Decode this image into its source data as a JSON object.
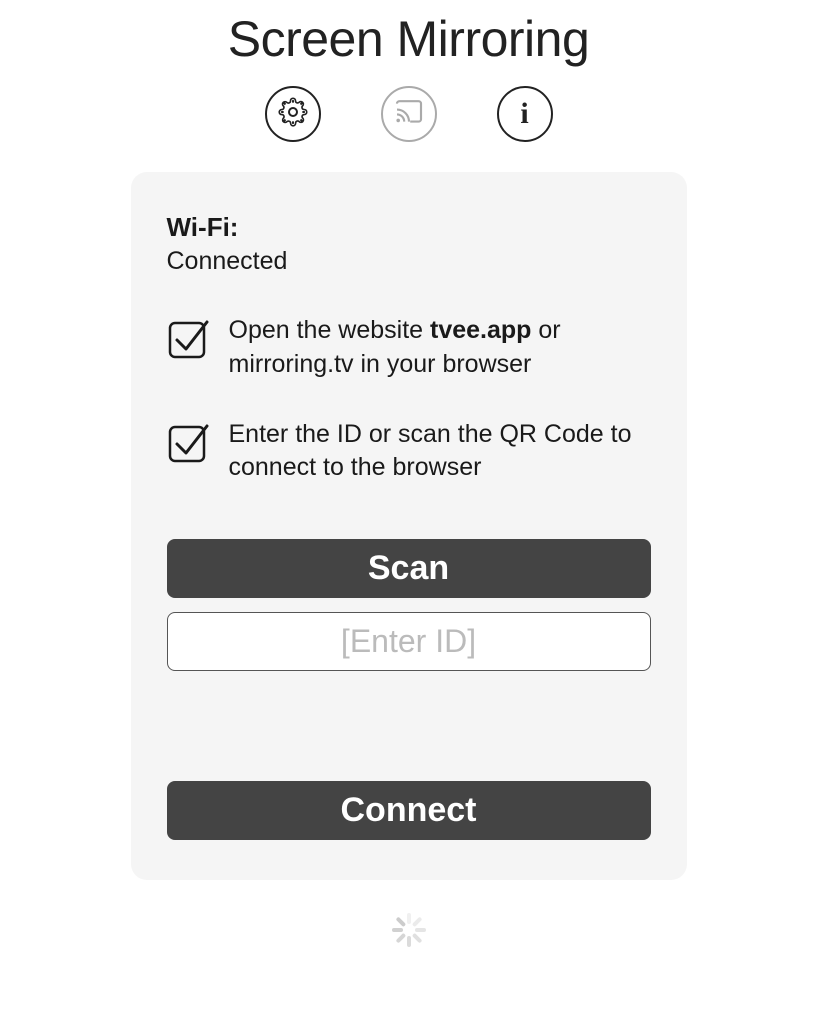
{
  "title": "Screen Mirroring",
  "wifi": {
    "label": "Wi-Fi:",
    "status": "Connected"
  },
  "steps": {
    "step1_pre": "Open the website ",
    "step1_bold": "tvee.app",
    "step1_post": " or mirroring.tv in your browser",
    "step2": "Enter the ID or scan the QR Code to connect to the browser"
  },
  "buttons": {
    "scan": "Scan",
    "connect": "Connect"
  },
  "input": {
    "placeholder": "[Enter ID]"
  }
}
